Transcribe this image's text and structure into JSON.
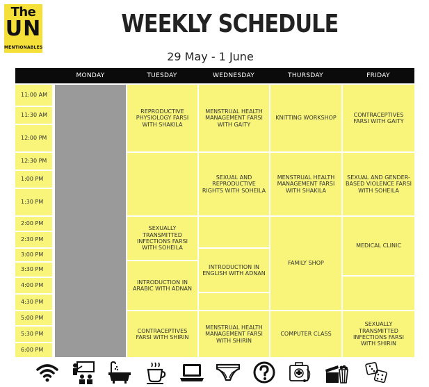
{
  "logo": {
    "line1": "The",
    "line2": "UN",
    "line3": "MENTIONABLES"
  },
  "title": "WEEKLY SCHEDULE",
  "subtitle": "29 May - 1 June",
  "days": [
    "MONDAY",
    "TUESDAY",
    "WEDNESDAY",
    "THURSDAY",
    "FRIDAY"
  ],
  "times": [
    "11:00 AM",
    "11:30 AM",
    "12:00 PM",
    "12:30 PM",
    "1:00 PM",
    "1:30 PM",
    "2:00 PM",
    "2:30 PM",
    "3:00 PM",
    "3:30 PM",
    "4:00 PM",
    "4:30 PM",
    "5:00 PM",
    "5:30 PM",
    "6:00 PM"
  ],
  "sessions": {
    "tue_1": "REPRODUCTIVE PHYSIOLOGY FARSI WITH SHAKILA",
    "tue_2": "SEXUALLY TRANSMITTED INFECTIONS FARSI WITH SOHEILA",
    "tue_3": "INTRODUCTION IN ARABIC WITH ADNAN",
    "tue_4": "CONTRACEPTIVES FARSI WITH SHIRIN",
    "wed_1": "MENSTRUAL HEALTH MANAGEMENT FARSI WITH GAITY",
    "wed_2": "SEXUAL AND REPRODUCTIVE RIGHTS WITH SOHEILA",
    "wed_3": "INTRODUCTION IN ENGLISH WITH ADNAN",
    "wed_4": "MENSTRUAL HEALTH MANAGEMENT FARSI WITH SHIRIN",
    "thu_1": "KNITTING WORKSHOP",
    "thu_2": "MENSTRUAL HEALTH MANAGEMENT FARSI WITH SHAKILA",
    "thu_3": "FAMILY SHOP",
    "thu_4": "COMPUTER CLASS",
    "fri_1": "CONTRACEPTIVES FARSI WITH GAITY",
    "fri_2": "SEXUAL AND GENDER-BASED VIOLENCE FARSI WITH SOHEILA",
    "fri_3": "MEDICAL CLINIC",
    "fri_4": "SEXUALLY TRANSMITTED INFECTIONS FARSI WITH SHIRIN"
  },
  "colors": {
    "accent": "#f8f57a",
    "header": "#0b0b0b",
    "monday_block": "#9a9a9a",
    "logo": "#f5e03a"
  },
  "icons": [
    "wifi-icon",
    "classroom-icon",
    "bathtub-icon",
    "coffee-icon",
    "laptop-icon",
    "underwear-icon",
    "question-icon",
    "medical-kit-icon",
    "cinema-icon",
    "dice-icon"
  ]
}
